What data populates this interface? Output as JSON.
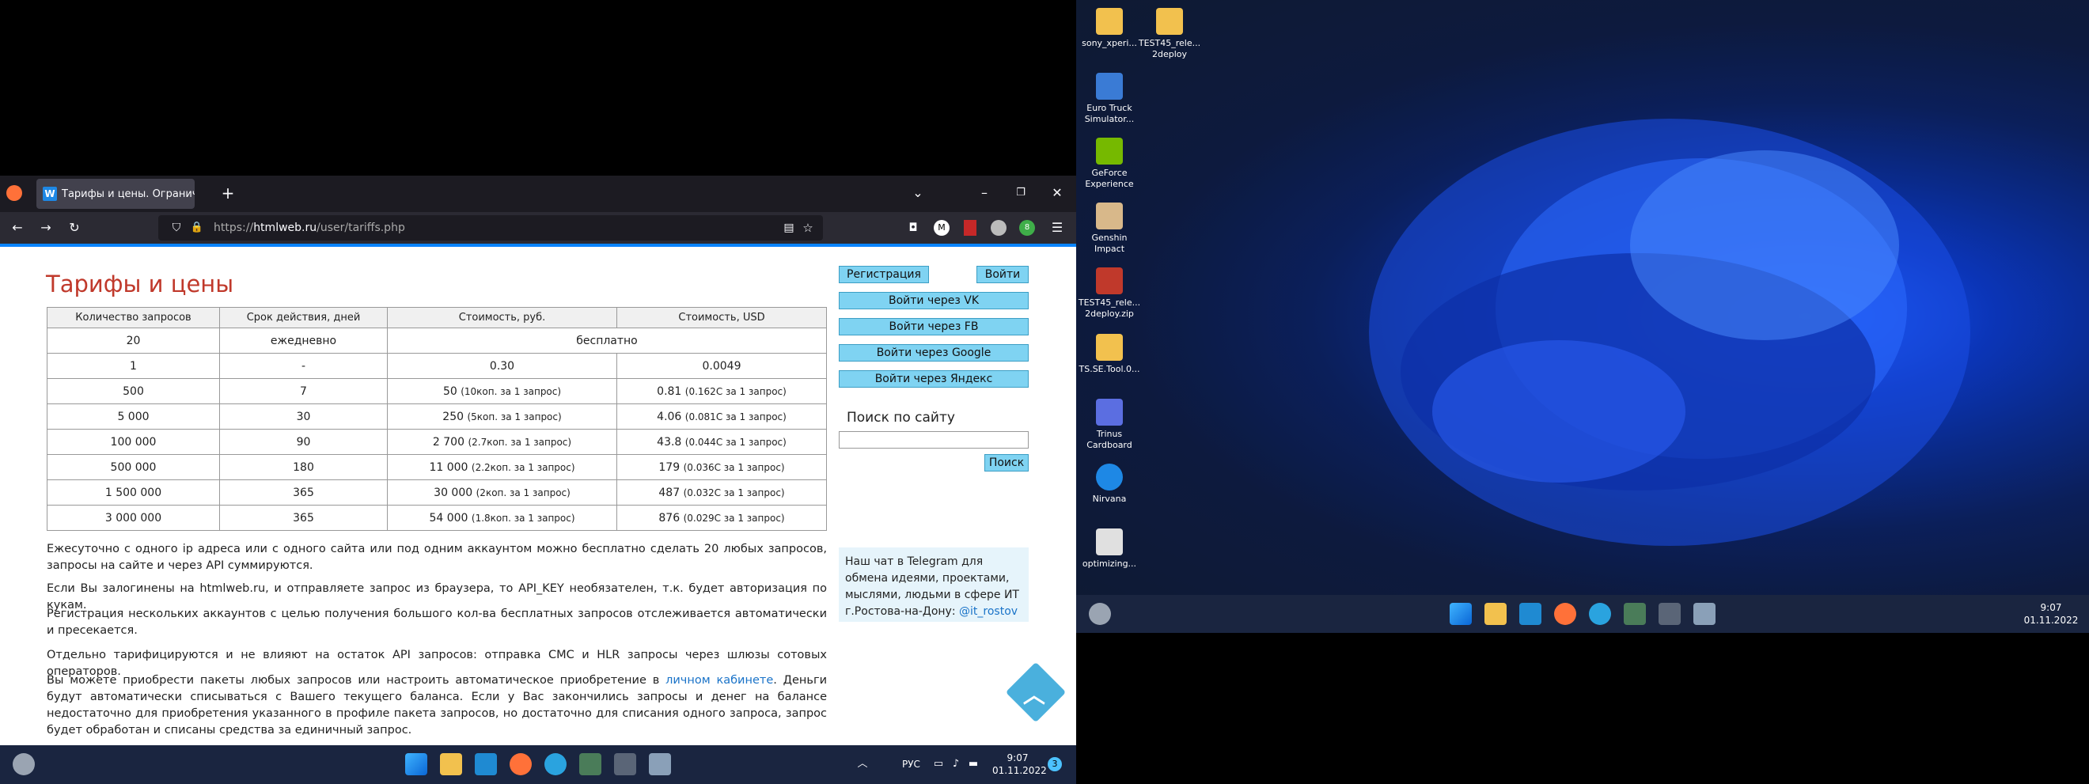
{
  "browser": {
    "tab_title": "Тарифы и цены. Ограничени",
    "favicon_letter": "W",
    "url_scheme": "https://",
    "url_host": "htmlweb.ru",
    "url_path": "/user/tariffs.php",
    "new_tab": "+",
    "window_min": "–",
    "window_restore": "❐",
    "window_close": "✕"
  },
  "page": {
    "title": "Тарифы и цены",
    "table": {
      "headers": [
        "Количество запросов",
        "Срок действия, дней",
        "Стоимость, руб.",
        "Стоимость, USD"
      ],
      "row_free": {
        "count": "20",
        "term": "ежедневно",
        "price": "бесплатно"
      },
      "rows": [
        {
          "count": "1",
          "term": "-",
          "rub": "0.30",
          "rub_note": "",
          "usd": "0.0049",
          "usd_note": ""
        },
        {
          "count": "500",
          "term": "7",
          "rub": "50",
          "rub_note": "(10коп. за 1 запрос)",
          "usd": "0.81",
          "usd_note": "(0.162С за 1 запрос)"
        },
        {
          "count": "5 000",
          "term": "30",
          "rub": "250",
          "rub_note": "(5коп. за 1 запрос)",
          "usd": "4.06",
          "usd_note": "(0.081С за 1 запрос)"
        },
        {
          "count": "100 000",
          "term": "90",
          "rub": "2 700",
          "rub_note": "(2.7коп. за 1 запрос)",
          "usd": "43.8",
          "usd_note": "(0.044С за 1 запрос)"
        },
        {
          "count": "500 000",
          "term": "180",
          "rub": "11 000",
          "rub_note": "(2.2коп. за 1 запрос)",
          "usd": "179",
          "usd_note": "(0.036С за 1 запрос)"
        },
        {
          "count": "1 500 000",
          "term": "365",
          "rub": "30 000",
          "rub_note": "(2коп. за 1 запрос)",
          "usd": "487",
          "usd_note": "(0.032С за 1 запрос)"
        },
        {
          "count": "3 000 000",
          "term": "365",
          "rub": "54 000",
          "rub_note": "(1.8коп. за 1 запрос)",
          "usd": "876",
          "usd_note": "(0.029С за 1 запрос)"
        }
      ]
    },
    "p1": "Ежесуточно с одного ip адреса или с одного сайта или под одним аккаунтом можно бесплатно сделать 20 любых запросов, запросы на сайте и через API суммируются.",
    "p2": "Если Вы залогинены на htmlweb.ru, и отправляете запрос из браузера, то API_KEY необязателен, т.к. будет авторизация по кукам.",
    "p3": "Регистрация нескольких аккаунтов с целью получения большого кол-ва бесплатных запросов отслеживается автоматически и пресекается.",
    "p4": "Отдельно тарифицируются и не влияют на остаток API запросов: отправка СМС и HLR запросы через шлюзы сотовых операторов.",
    "p5_a": "Вы можете приобрести пакеты любых запросов или настроить автоматическое приобретение в",
    "p5_link": "личном кабинете",
    "p5_b": ". Деньги будут автоматически списываться с Вашего текущего баланса. Если у Вас закончились запросы и денег на балансе недостаточно для приобретения указанного в профиле пакета запросов, но достаточно для списания одного запроса, запрос будет обработан и списаны средства за единичный запрос.",
    "sidebar": {
      "register": "Регистрация",
      "login": "Войти",
      "vk": "Войти через VK",
      "fb": "Войти через FB",
      "google": "Войти через Google",
      "yandex": "Войти через Яндекс",
      "search_title": "Поиск по сайту",
      "search_btn": "Поиск",
      "tg_text": "Наш чат в Telegram для обмена идеями, проектами, мыслями, людьми в сфере ИТ г.Ростова-на-Дону:",
      "tg_link": "@it_rostov"
    }
  },
  "taskbar_left": {
    "lang": "РУС",
    "time": "9:07",
    "date": "01.11.2022",
    "notif": "3"
  },
  "taskbar_right": {
    "time": "9:07",
    "date": "01.11.2022"
  },
  "desktop_icons": [
    {
      "label": "sony_xperi...",
      "color": "#f2c14e"
    },
    {
      "label": "TEST45_rele... 2deploy",
      "color": "#f2c14e"
    },
    {
      "label": "Euro Truck Simulator...",
      "color": "#3a7bd5"
    },
    {
      "label": "GeForce Experience",
      "color": "#76b900"
    },
    {
      "label": "Genshin Impact",
      "color": "#d8b88a"
    },
    {
      "label": "TEST45_rele... 2deploy.zip",
      "color": "#c0392b"
    },
    {
      "label": "TS.SE.Tool.0...",
      "color": "#f2c14e"
    },
    {
      "label": "Trinus Cardboard",
      "color": "#5b6ee1"
    },
    {
      "label": "Nirvana",
      "color": "#1e88e5"
    },
    {
      "label": "optimizing...",
      "color": "#e0e0e0"
    }
  ]
}
